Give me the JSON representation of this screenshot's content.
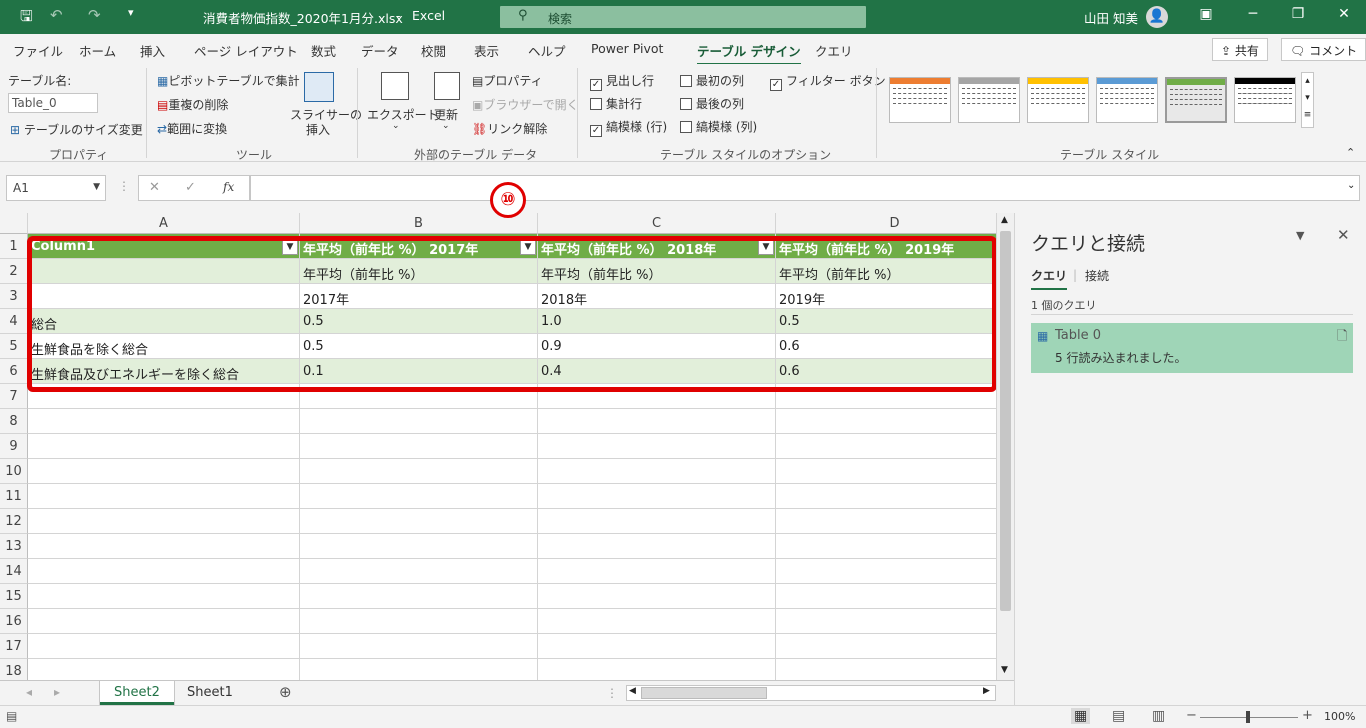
{
  "title_bar": {
    "doc_title": "消費者物価指数_2020年1月分.xlsx",
    "app_name": "Excel",
    "separator": "-",
    "search_label": "検索",
    "user_name": "山田 知美"
  },
  "tabs": [
    "ファイル",
    "ホーム",
    "挿入",
    "ページ レイアウト",
    "数式",
    "データ",
    "校閲",
    "表示",
    "ヘルプ",
    "Power Pivot",
    "テーブル デザイン",
    "クエリ"
  ],
  "active_tab": "テーブル デザイン",
  "share_label": "共有",
  "comment_label": "コメント",
  "ribbon": {
    "table_name_label": "テーブル名:",
    "table_name_value": "Table_0",
    "resize_label": "テーブルのサイズ変更",
    "group_properties": "プロパティ",
    "pivot_label": "ピボットテーブルで集計",
    "remove_dup_label": "重複の削除",
    "convert_range_label": "範囲に変換",
    "slicer_label_1": "スライサーの",
    "slicer_label_2": "挿入",
    "group_tools": "ツール",
    "export_label": "エクスポート",
    "refresh_label": "更新",
    "properties_label": "プロパティ",
    "browser_label": "ブラウザーで開く",
    "unlink_label": "リンク解除",
    "group_external": "外部のテーブル データ",
    "opt_header_row": "見出し行",
    "opt_total_row": "集計行",
    "opt_banded_rows": "縞模様 (行)",
    "opt_first_col": "最初の列",
    "opt_last_col": "最後の列",
    "opt_banded_cols": "縞模様 (列)",
    "opt_filter_btn": "フィルター ボタン",
    "group_style_options": "テーブル スタイルのオプション",
    "group_styles": "テーブル スタイル",
    "style_colors": [
      "#ed7d31",
      "#a5a5a5",
      "#ffc000",
      "#5b9bd5",
      "#70ad47",
      "#000000"
    ]
  },
  "formula_bar": {
    "name_box": "A1",
    "fx": "fx",
    "content": ""
  },
  "badge": "⑩",
  "columns": [
    "A",
    "B",
    "C",
    "D"
  ],
  "rows": [
    {
      "num": "1",
      "cells": [
        "Column1",
        "年平均（前年比 %） 2017年",
        "年平均（前年比 %） 2018年",
        "年平均（前年比 %） 2019年"
      ]
    },
    {
      "num": "2",
      "cells": [
        "",
        "年平均（前年比 %）",
        "年平均（前年比 %）",
        "年平均（前年比 %）"
      ]
    },
    {
      "num": "3",
      "cells": [
        "",
        "2017年",
        "2018年",
        "2019年"
      ]
    },
    {
      "num": "4",
      "cells": [
        "総合",
        "0.5",
        "1.0",
        "0.5"
      ]
    },
    {
      "num": "5",
      "cells": [
        "生鮮食品を除く総合",
        "0.5",
        "0.9",
        "0.6"
      ]
    },
    {
      "num": "6",
      "cells": [
        "生鮮食品及びエネルギーを除く総合",
        "0.1",
        "0.4",
        "0.6"
      ]
    },
    {
      "num": "7",
      "cells": [
        "",
        "",
        "",
        ""
      ]
    },
    {
      "num": "8",
      "cells": [
        "",
        "",
        "",
        ""
      ]
    },
    {
      "num": "9",
      "cells": [
        "",
        "",
        "",
        ""
      ]
    },
    {
      "num": "10",
      "cells": [
        "",
        "",
        "",
        ""
      ]
    },
    {
      "num": "11",
      "cells": [
        "",
        "",
        "",
        ""
      ]
    },
    {
      "num": "12",
      "cells": [
        "",
        "",
        "",
        ""
      ]
    },
    {
      "num": "13",
      "cells": [
        "",
        "",
        "",
        ""
      ]
    },
    {
      "num": "14",
      "cells": [
        "",
        "",
        "",
        ""
      ]
    },
    {
      "num": "15",
      "cells": [
        "",
        "",
        "",
        ""
      ]
    },
    {
      "num": "16",
      "cells": [
        "",
        "",
        "",
        ""
      ]
    },
    {
      "num": "17",
      "cells": [
        "",
        "",
        "",
        ""
      ]
    },
    {
      "num": "18",
      "cells": [
        "",
        "",
        "",
        ""
      ]
    }
  ],
  "sheets": [
    "Sheet2",
    "Sheet1"
  ],
  "active_sheet": "Sheet2",
  "pane": {
    "title": "クエリと接続",
    "tab_queries": "クエリ",
    "tab_connections": "接続",
    "count": "1 個のクエリ",
    "query_name": "Table 0",
    "query_status": "5 行読み込まれました。"
  },
  "status": {
    "zoom": "100%"
  }
}
